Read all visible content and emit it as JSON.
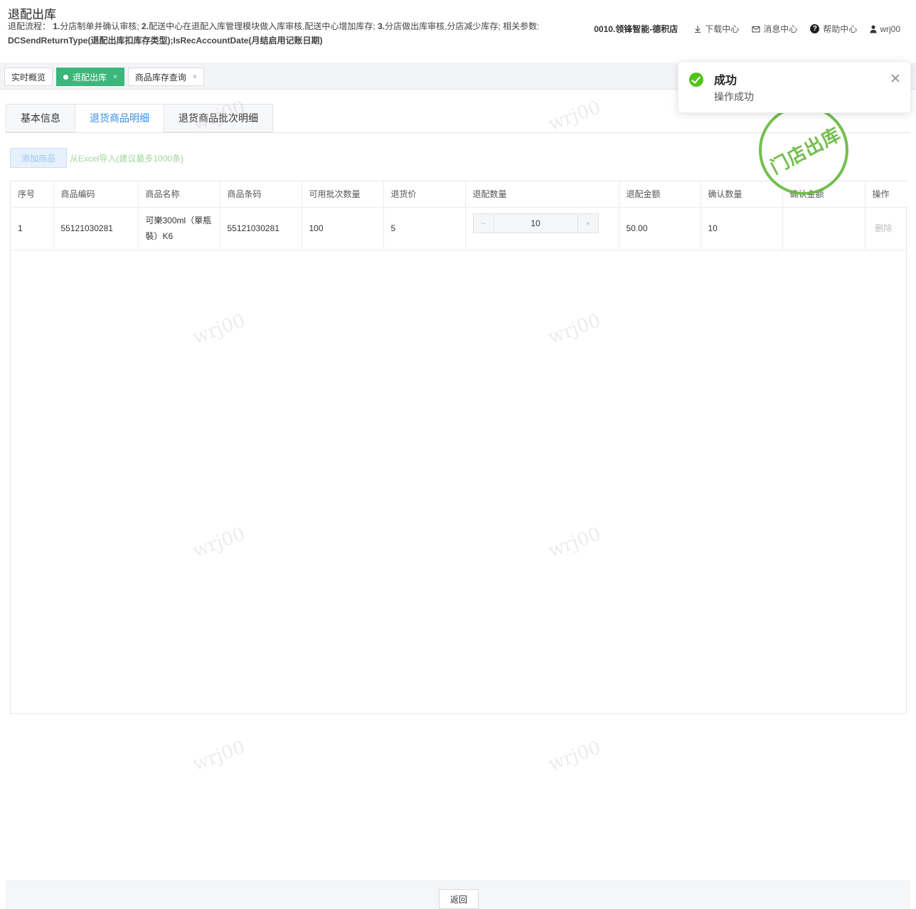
{
  "header": {
    "title": "退配出库",
    "desc_label": "退配流程：",
    "desc_step1": "1.",
    "desc_step1_text": "分店制单并确认审核; ",
    "desc_step2": "2.",
    "desc_step2_text": "配送中心在退配入库管理模块做入库审核,配送中心增加库存; ",
    "desc_step3": "3.",
    "desc_step3_text": "分店做出库审核,分店减少库存; 相关参数: ",
    "desc_param1": "DCSendReturnType",
    "desc_param1_text": "(退配出库扣库存类型);",
    "desc_param2": "IsRecAccountDate",
    "desc_param2_text": "(月结启用记账日期)",
    "store": "0010.领锋智能-德积店",
    "download": "下载中心",
    "messages": "消息中心",
    "help": "帮助中心",
    "user": "wrj00"
  },
  "tabs": [
    {
      "label": "实时概览",
      "closable": false,
      "active": false
    },
    {
      "label": "退配出库",
      "closable": true,
      "active": true
    },
    {
      "label": "商品库存查询",
      "closable": true,
      "active": false
    }
  ],
  "tab_close": "×",
  "subtabs": [
    {
      "label": "基本信息",
      "active": false
    },
    {
      "label": "退货商品明细",
      "active": true
    },
    {
      "label": "退货商品批次明细",
      "active": false
    }
  ],
  "actions": {
    "add": "添加商品",
    "import": "从Excel导入(建议最多1000条)"
  },
  "table": {
    "columns": [
      "序号",
      "商品编码",
      "商品名称",
      "商品条码",
      "可用批次数量",
      "退货价",
      "退配数量",
      "退配金额",
      "确认数量",
      "确认金额",
      "操作"
    ],
    "rows": [
      {
        "index": "1",
        "code": "55121030281",
        "name": "可樂300ml（單瓶裝）K6",
        "barcode": "55121030281",
        "available": "100",
        "price": "5",
        "qty": "10",
        "amount": "50.00",
        "confirm_qty": "10",
        "confirm_amount": "",
        "action": "删除"
      }
    ],
    "stepper_minus": "−",
    "stepper_plus": "+"
  },
  "footer": {
    "back": "返回"
  },
  "notification": {
    "title": "成功",
    "message": "操作成功"
  },
  "stamp": "门店出库",
  "watermark": "wrj00",
  "colors": {
    "accent": "#3cb67a",
    "link": "#3a8ee6",
    "success": "#52c41a",
    "stamp": "#6dbb45"
  }
}
